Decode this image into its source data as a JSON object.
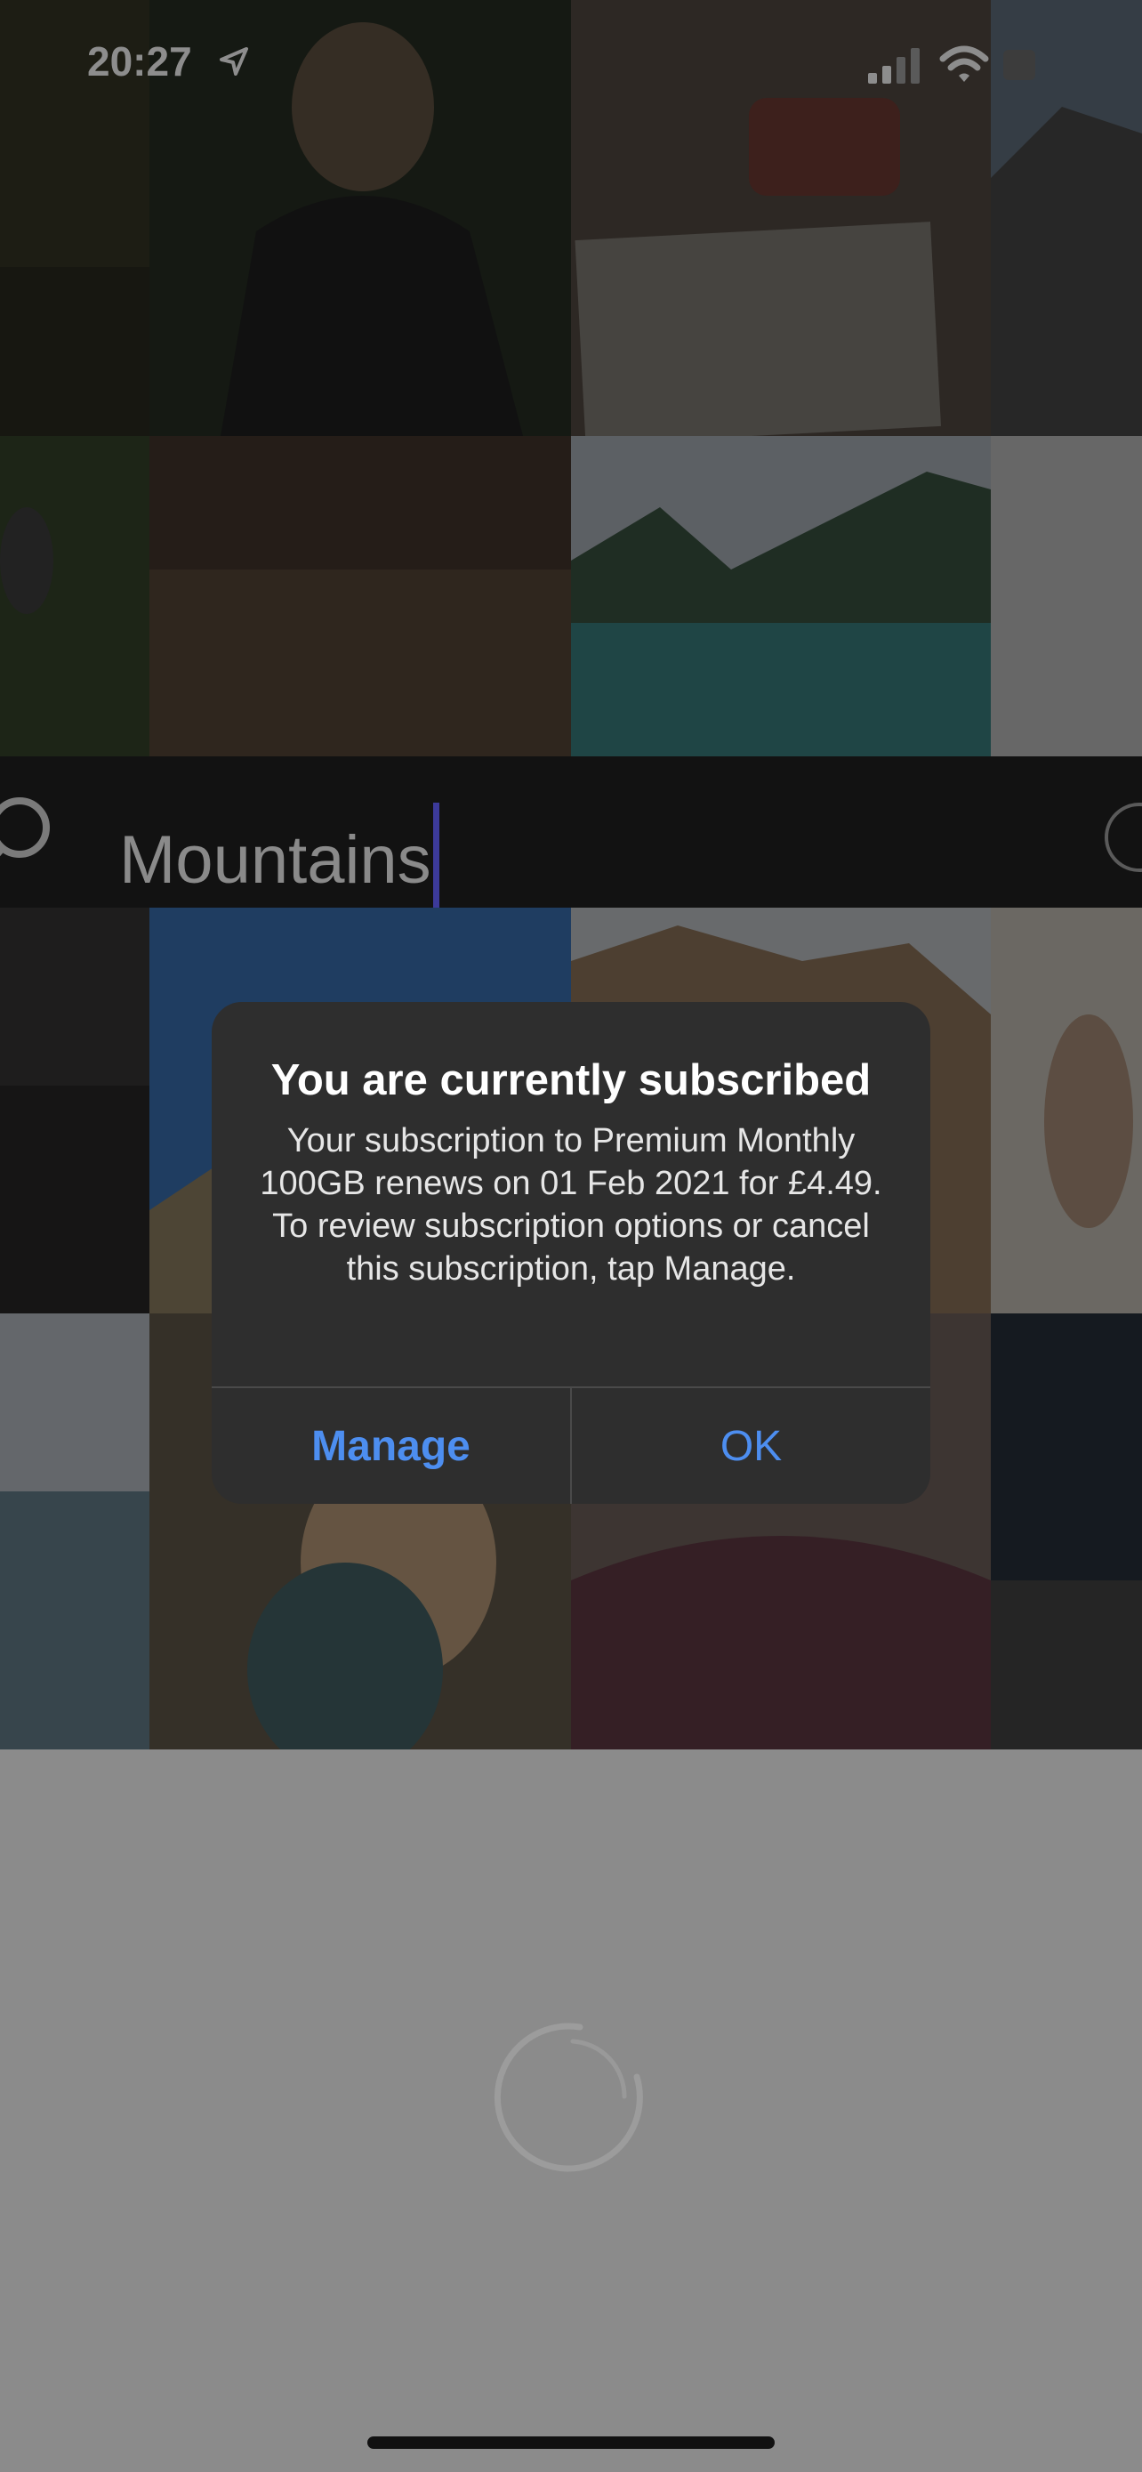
{
  "status_bar": {
    "time": "20:27",
    "icons": [
      "location-arrow-icon",
      "cellular-signal-icon",
      "wifi-icon",
      "battery-icon"
    ]
  },
  "search": {
    "query": "Mountains",
    "icons": [
      "search-icon"
    ]
  },
  "alert": {
    "title": "You are currently subscribed",
    "message": "Your subscription to Premium Monthly 100GB renews on 01 Feb 2021 for £4.49. To review subscription options or cancel this subscription, tap Manage.",
    "buttons": {
      "manage": "Manage",
      "ok": "OK"
    }
  },
  "colors": {
    "accent": "#4d8ef0",
    "alert_bg": "#2e2e2e",
    "overlay_gray": "#8b8b8b"
  },
  "loading_indicator": "spinner-icon"
}
